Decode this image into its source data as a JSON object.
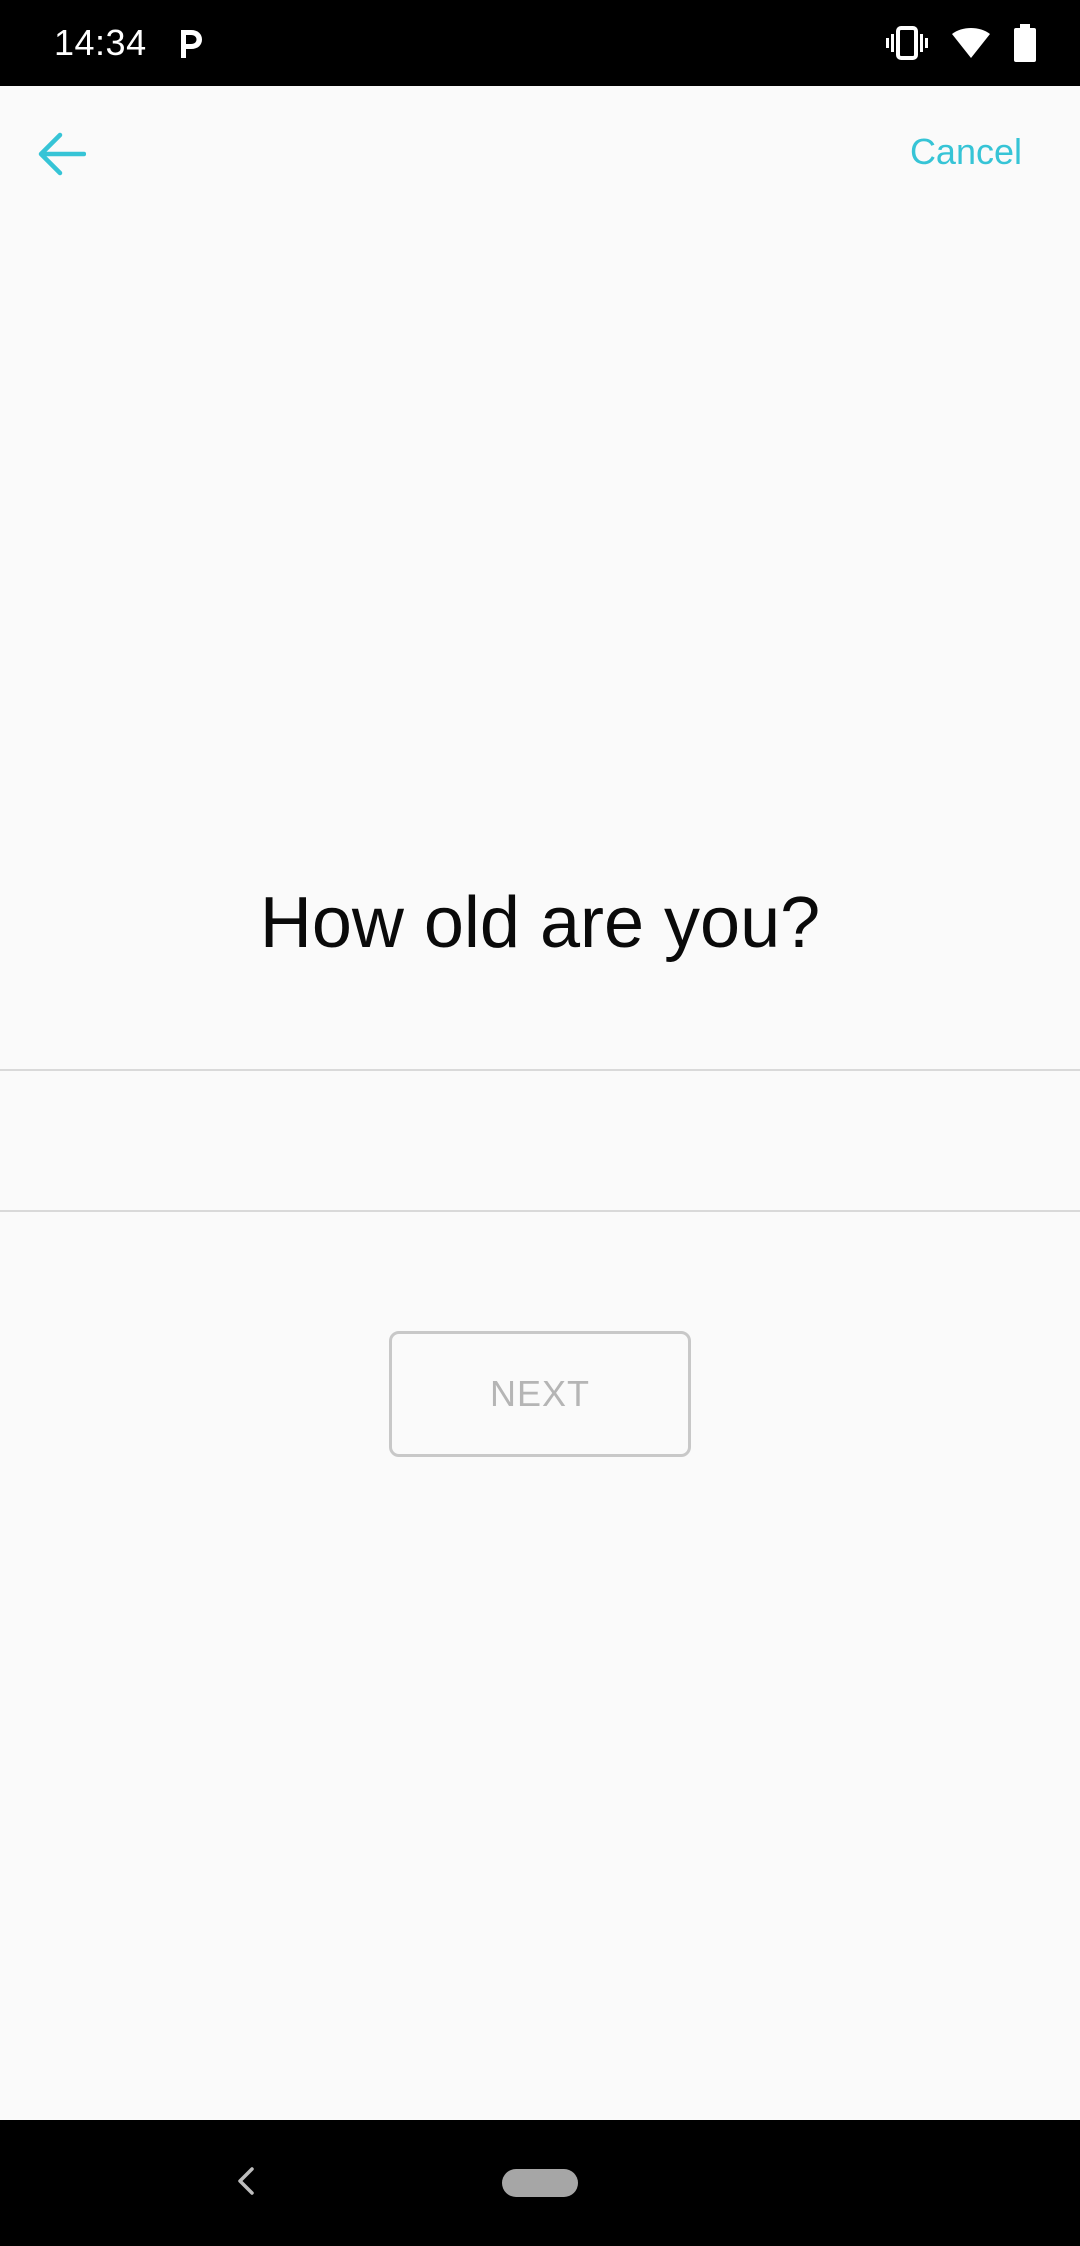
{
  "status_bar": {
    "time": "14:34",
    "icons": [
      "parking-app-icon",
      "vibrate-icon",
      "wifi-icon",
      "battery-icon"
    ]
  },
  "app_bar": {
    "back_icon": "arrow-left-icon",
    "cancel_label": "Cancel",
    "accent_color": "#36c4d6"
  },
  "main": {
    "question": "How old are you?",
    "age_value": "",
    "next_label": "NEXT"
  },
  "nav_bar": {
    "icons": [
      "nav-back-icon",
      "nav-home-pill"
    ]
  }
}
